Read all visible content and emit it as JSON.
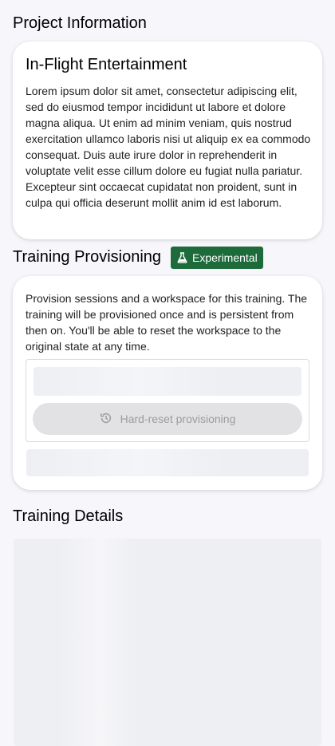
{
  "project_info": {
    "section_title": "Project Information",
    "card_title": "In-Flight Entertainment",
    "description": "Lorem ipsum dolor sit amet, consectetur adipiscing elit, sed do eiusmod tempor incididunt ut labore et dolore magna aliqua. Ut enim ad minim veniam, quis nostrud exercitation ullamco laboris nisi ut aliquip ex ea commodo consequat. Duis aute irure dolor in reprehenderit in voluptate velit esse cillum dolore eu fugiat nulla pariatur. Excepteur sint occaecat cupidatat non proident, sunt in culpa qui officia deserunt mollit anim id est laborum."
  },
  "provisioning": {
    "section_title": "Training Provisioning",
    "badge_label": "Experimental",
    "badge_icon": "flask-icon",
    "description": "Provision sessions and a workspace for this training. The training will be provisioned once and is persistent from then on. You'll be able to reset the workspace to the original state at any time.",
    "reset_button_label": "Hard-reset provisioning",
    "reset_button_icon": "history-icon"
  },
  "details": {
    "section_title": "Training Details"
  },
  "colors": {
    "badge_background": "#1d6b3a",
    "page_background": "#f6f6fb",
    "disabled_button": "#e2e2e4"
  }
}
